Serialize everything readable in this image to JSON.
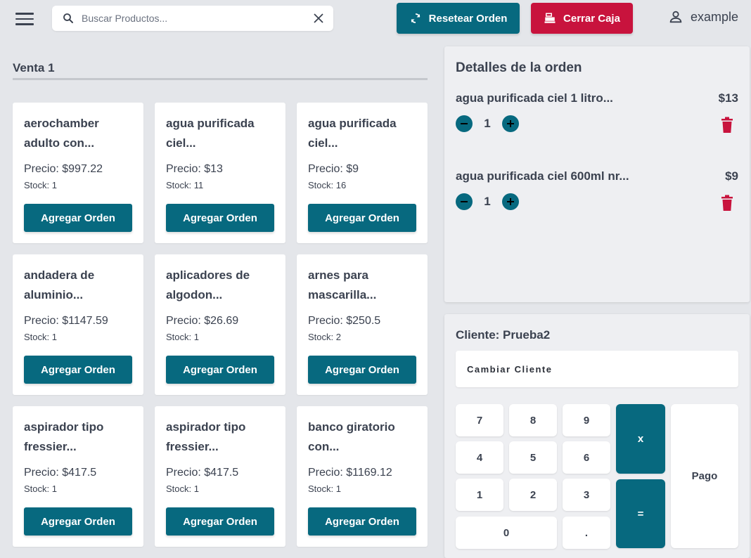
{
  "search": {
    "placeholder": "Buscar Productos..."
  },
  "header": {
    "reset_label": "Resetear Orden",
    "close_label": "Cerrar Caja",
    "username": "example"
  },
  "venta": {
    "title": "Venta 1"
  },
  "products": [
    {
      "name": "aerochamber\nadulto con...",
      "price": "Precio: $997.22",
      "stock": "Stock: 1",
      "button": "Agregar Orden"
    },
    {
      "name": "agua purificada\nciel...",
      "price": "Precio: $13",
      "stock": "Stock: 11",
      "button": "Agregar Orden"
    },
    {
      "name": "agua purificada\nciel...",
      "price": "Precio: $9",
      "stock": "Stock: 16",
      "button": "Agregar Orden"
    },
    {
      "name": "andadera de\naluminio...",
      "price": "Precio: $1147.59",
      "stock": "Stock: 1",
      "button": "Agregar Orden"
    },
    {
      "name": "aplicadores de\nalgodon...",
      "price": "Precio: $26.69",
      "stock": "Stock: 1",
      "button": "Agregar Orden"
    },
    {
      "name": "arnes para\nmascarilla...",
      "price": "Precio: $250.5",
      "stock": "Stock: 2",
      "button": "Agregar Orden"
    },
    {
      "name": "aspirador tipo\nfressier...",
      "price": "Precio: $417.5",
      "stock": "Stock: 1",
      "button": "Agregar Orden"
    },
    {
      "name": "aspirador tipo\nfressier...",
      "price": "Precio: $417.5",
      "stock": "Stock: 1",
      "button": "Agregar Orden"
    },
    {
      "name": "banco giratorio\ncon...",
      "price": "Precio: $1169.12",
      "stock": "Stock: 1",
      "button": "Agregar Orden"
    }
  ],
  "order": {
    "title": "Detalles de la orden",
    "items": [
      {
        "name": "agua purificada ciel 1 litro...",
        "price": "$13",
        "qty": "1"
      },
      {
        "name": "agua purificada ciel 600ml nr...",
        "price": "$9",
        "qty": "1"
      }
    ]
  },
  "client": {
    "title": "Cliente: Prueba2",
    "change_label": "Cambiar Cliente"
  },
  "keypad": {
    "k7": "7",
    "k8": "8",
    "k9": "9",
    "k4": "4",
    "k5": "5",
    "k6": "6",
    "k1": "1",
    "k2": "2",
    "k3": "3",
    "k0": "0",
    "dot": ".",
    "mul": "x",
    "eq": "=",
    "pay": "Pago"
  },
  "colors": {
    "accent": "#07697f",
    "danger": "#c8133d",
    "background": "#e4e6ea"
  }
}
